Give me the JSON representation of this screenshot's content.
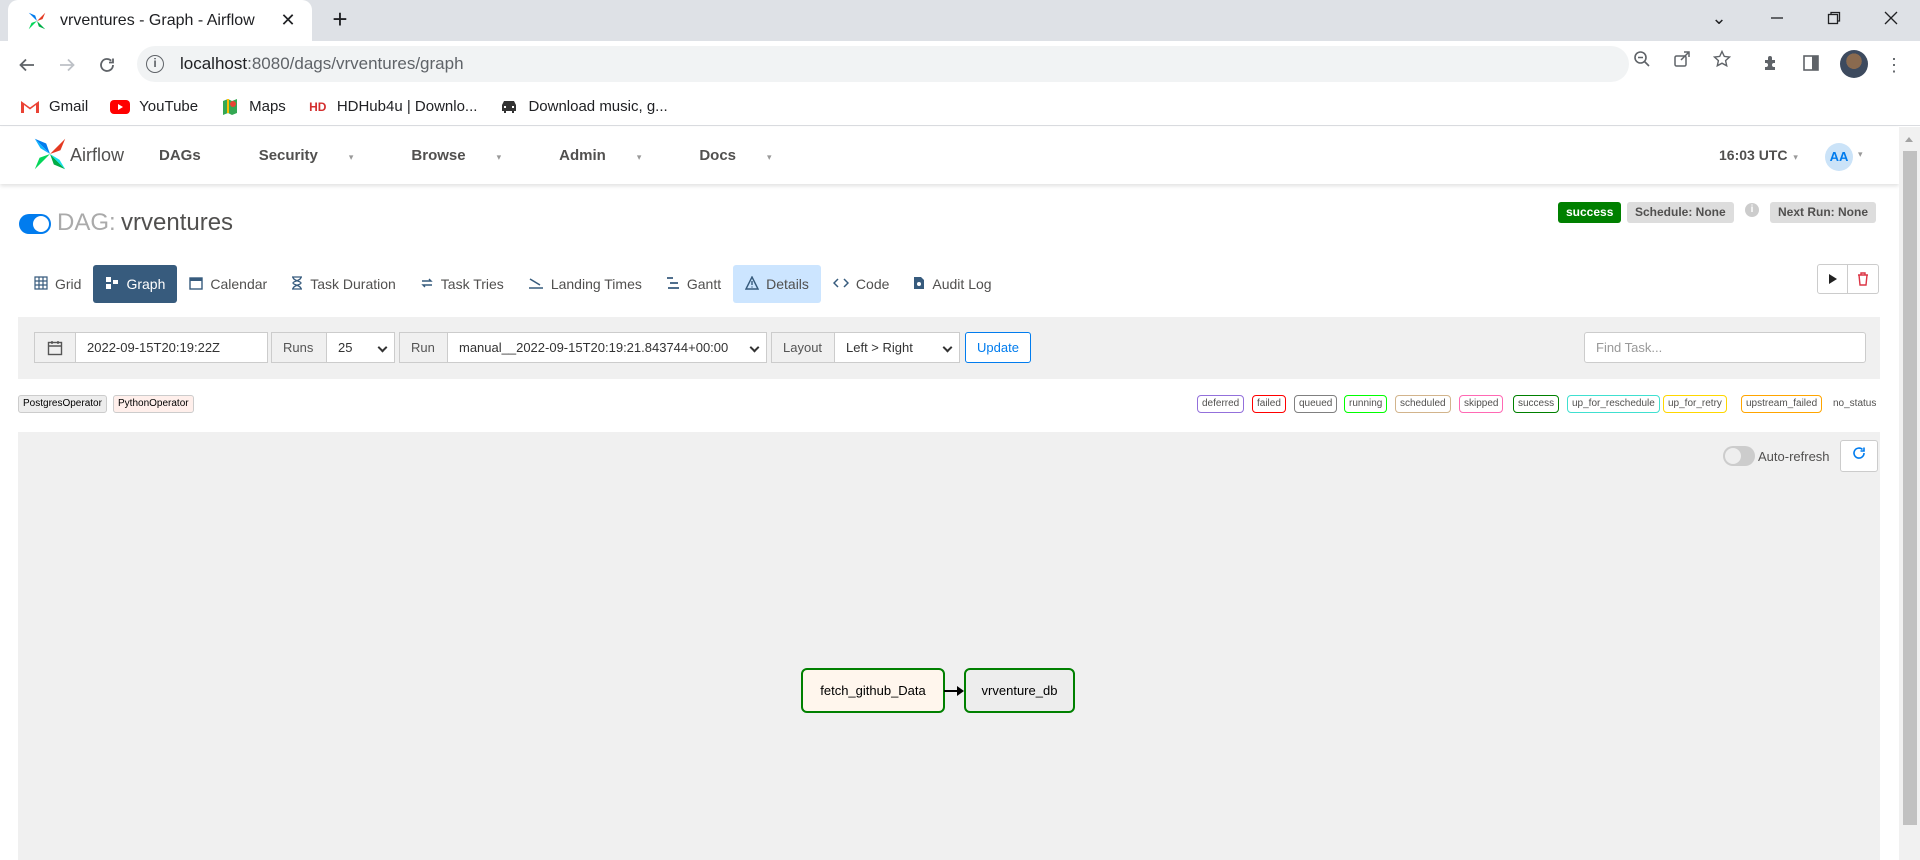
{
  "browser": {
    "tab_title": "vrventures - Graph - Airflow",
    "tab_close": "✕",
    "new_tab": "+",
    "url_host": "localhost",
    "url_rest": ":8080/dags/vrventures/graph",
    "bookmarks": [
      {
        "label": "Gmail",
        "icon": "gmail-icon"
      },
      {
        "label": "YouTube",
        "icon": "youtube-icon"
      },
      {
        "label": "Maps",
        "icon": "maps-icon"
      },
      {
        "label": "HDHub4u | Downlo...",
        "icon": "hdhub-icon"
      },
      {
        "label": "Download music, g...",
        "icon": "car-icon"
      }
    ]
  },
  "airflow": {
    "brand": "Airflow",
    "menu": [
      "DAGs",
      "Security",
      "Browse",
      "Admin",
      "Docs"
    ],
    "time": "16:03 UTC",
    "user_initials": "AA"
  },
  "dag": {
    "label": "DAG:",
    "id": "vrventures",
    "state": "success",
    "schedule": "Schedule: None",
    "next_run": "Next Run: None",
    "paused": false
  },
  "views": [
    {
      "label": "Grid",
      "icon": "grid-icon"
    },
    {
      "label": "Graph",
      "icon": "graph-icon",
      "active": true
    },
    {
      "label": "Calendar",
      "icon": "calendar-icon"
    },
    {
      "label": "Task Duration",
      "icon": "hourglass-icon"
    },
    {
      "label": "Task Tries",
      "icon": "retry-icon"
    },
    {
      "label": "Landing Times",
      "icon": "landing-icon"
    },
    {
      "label": "Gantt",
      "icon": "gantt-icon"
    },
    {
      "label": "Details",
      "icon": "details-icon"
    },
    {
      "label": "Code",
      "icon": "code-icon"
    },
    {
      "label": "Audit Log",
      "icon": "audit-log-icon"
    }
  ],
  "filters": {
    "base_date": "2022-09-15T20:19:22Z",
    "runs_label": "Runs",
    "runs_value": "25",
    "run_label": "Run",
    "run_value": "manual__2022-09-15T20:19:21.843744+00:00",
    "layout_label": "Layout",
    "layout_value": "Left > Right",
    "update_label": "Update",
    "find_placeholder": "Find Task..."
  },
  "operators": [
    {
      "label": "PostgresOperator",
      "color": "#ededed"
    },
    {
      "label": "PythonOperator",
      "color": "#ffefeb"
    }
  ],
  "states": [
    {
      "label": "deferred",
      "color": "#9370db"
    },
    {
      "label": "failed",
      "color": "#ff0000"
    },
    {
      "label": "queued",
      "color": "#808080"
    },
    {
      "label": "running",
      "color": "#00ff00"
    },
    {
      "label": "scheduled",
      "color": "#d2b48c"
    },
    {
      "label": "skipped",
      "color": "#ff69b4"
    },
    {
      "label": "success",
      "color": "#008000"
    },
    {
      "label": "up_for_reschedule",
      "color": "#40e0d0"
    },
    {
      "label": "up_for_retry",
      "color": "#ffd700"
    },
    {
      "label": "upstream_failed",
      "color": "#ffa500"
    },
    {
      "label": "no_status",
      "color": "#ffffff"
    }
  ],
  "graph": {
    "auto_refresh_label": "Auto-refresh",
    "auto_refresh_on": false,
    "nodes": [
      {
        "label": "fetch_github_Data",
        "operator": "PythonOperator",
        "state": "success"
      },
      {
        "label": "vrventure_db",
        "operator": "PostgresOperator",
        "state": "success"
      }
    ]
  }
}
